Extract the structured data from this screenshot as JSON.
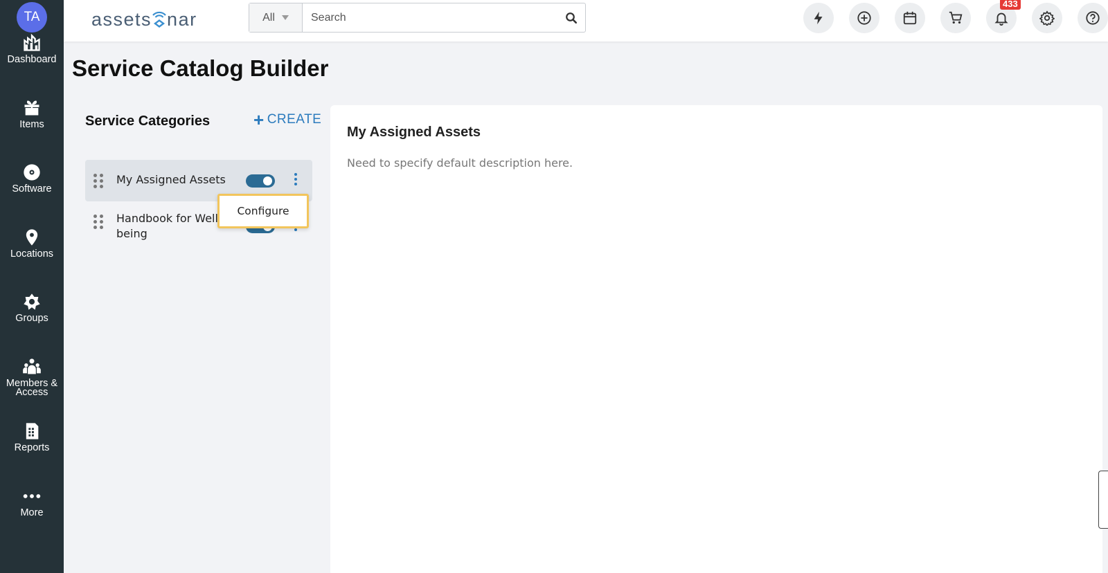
{
  "user": {
    "initials": "TA"
  },
  "sidebar": {
    "items": [
      {
        "label": "Dashboard",
        "icon": "dashboard-icon"
      },
      {
        "label": "Items",
        "icon": "items-icon"
      },
      {
        "label": "Software",
        "icon": "software-icon"
      },
      {
        "label": "Locations",
        "icon": "location-pin-icon"
      },
      {
        "label": "Groups",
        "icon": "groups-icon"
      },
      {
        "label": "Members &\nAccess",
        "icon": "members-icon"
      },
      {
        "label": "Reports",
        "icon": "reports-icon"
      },
      {
        "label": "More",
        "icon": "more-dots-icon"
      }
    ]
  },
  "header": {
    "logo_left": "assets",
    "logo_right": "nar",
    "search": {
      "scope": "All",
      "placeholder": "Search"
    },
    "notifications_count": "433"
  },
  "page": {
    "title": "Service Catalog Builder",
    "categories_title": "Service Categories",
    "create_label": "CREATE",
    "categories": [
      {
        "name": "My Assigned Assets",
        "enabled": true,
        "selected": true
      },
      {
        "name": "Handbook for Well-being",
        "enabled": true,
        "selected": false
      }
    ],
    "dropdown_item": "Configure",
    "detail": {
      "title": "My Assigned Assets",
      "description": "Need to specify default description here."
    }
  },
  "colors": {
    "sidebar": "#253238",
    "accent": "#2c7bbd",
    "toggle": "#2b6b94",
    "badge": "#e53935"
  }
}
